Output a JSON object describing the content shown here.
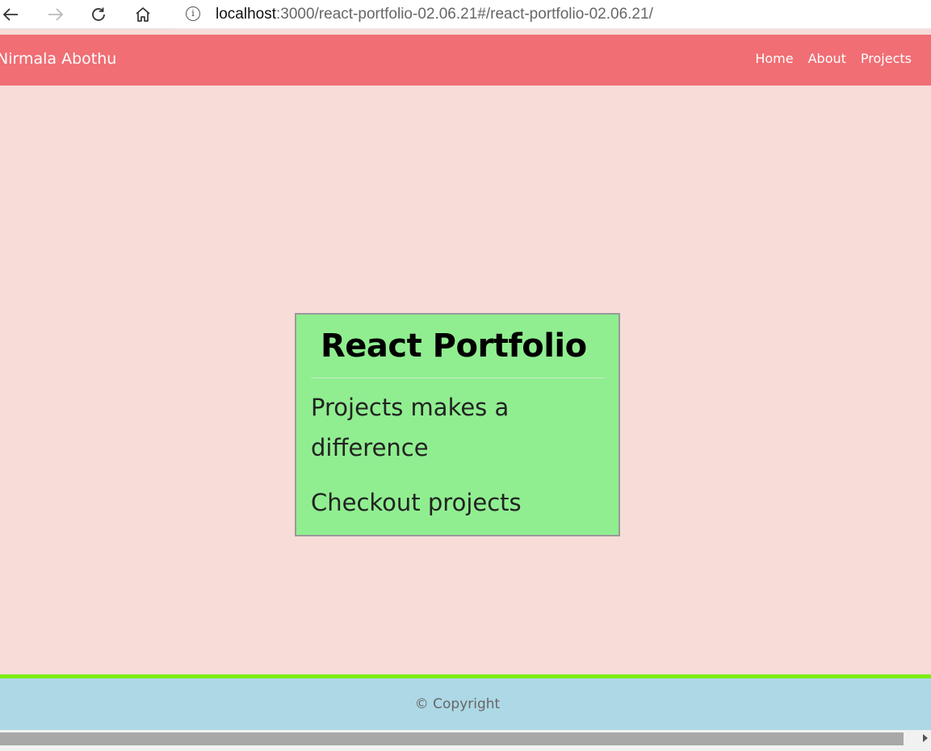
{
  "browser": {
    "url_host": "localhost",
    "url_rest": ":3000/react-portfolio-02.06.21#/react-portfolio-02.06.21/"
  },
  "navbar": {
    "brand": "Nirmala Abothu",
    "links": [
      "Home",
      "About",
      "Projects"
    ],
    "background_color": "#f06e74"
  },
  "card": {
    "title": "React Portfolio",
    "text": "Projects makes a difference",
    "link_label": "Checkout projects",
    "background_color": "#90ee90"
  },
  "footer": {
    "copyright": "© Copyright",
    "background_color": "#add8e6",
    "accent_line_color": "#7cec10"
  },
  "page": {
    "background_color": "#f7dcd8"
  }
}
